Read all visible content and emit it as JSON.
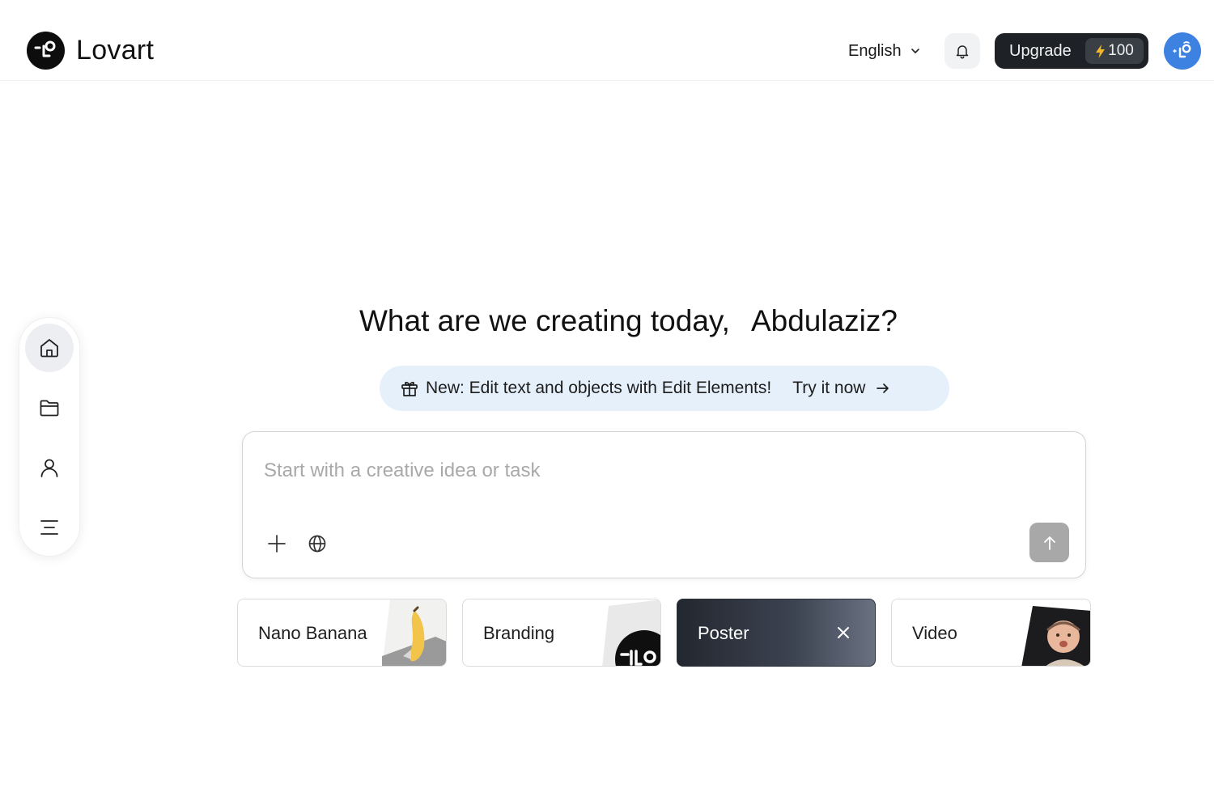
{
  "header": {
    "brand": "Lovart",
    "language": "English",
    "upgrade_label": "Upgrade",
    "credits": "100",
    "icons": [
      "lovart-logo-icon",
      "chevron-down-icon",
      "bell-icon",
      "lightning-icon",
      "user-avatar"
    ]
  },
  "sidebar": {
    "items": [
      {
        "icon": "home-icon",
        "active": true
      },
      {
        "icon": "folder-icon",
        "active": false
      },
      {
        "icon": "user-icon",
        "active": false
      },
      {
        "icon": "menu-icon",
        "active": false
      }
    ]
  },
  "main": {
    "greeting": "What are we creating today,",
    "user_name": "Abdulaziz?",
    "banner": {
      "text": "New: Edit text and objects with Edit Elements!",
      "cta": "Try it now",
      "icons": [
        "gift-icon",
        "arrow-right-icon"
      ]
    },
    "prompt": {
      "placeholder": "Start with a creative idea or task",
      "value": "",
      "icons": [
        "plus-icon",
        "globe-icon",
        "arrow-up-icon"
      ]
    },
    "cards": [
      {
        "label": "Nano Banana",
        "selected": false
      },
      {
        "label": "Branding",
        "selected": false
      },
      {
        "label": "Poster",
        "selected": true
      },
      {
        "label": "Video",
        "selected": false
      }
    ]
  },
  "colors": {
    "accent_dark": "#1e2126",
    "avatar_blue": "#3d82e0",
    "banner_bg": "#e6f0fb",
    "send_disabled": "#a8a8a8"
  }
}
